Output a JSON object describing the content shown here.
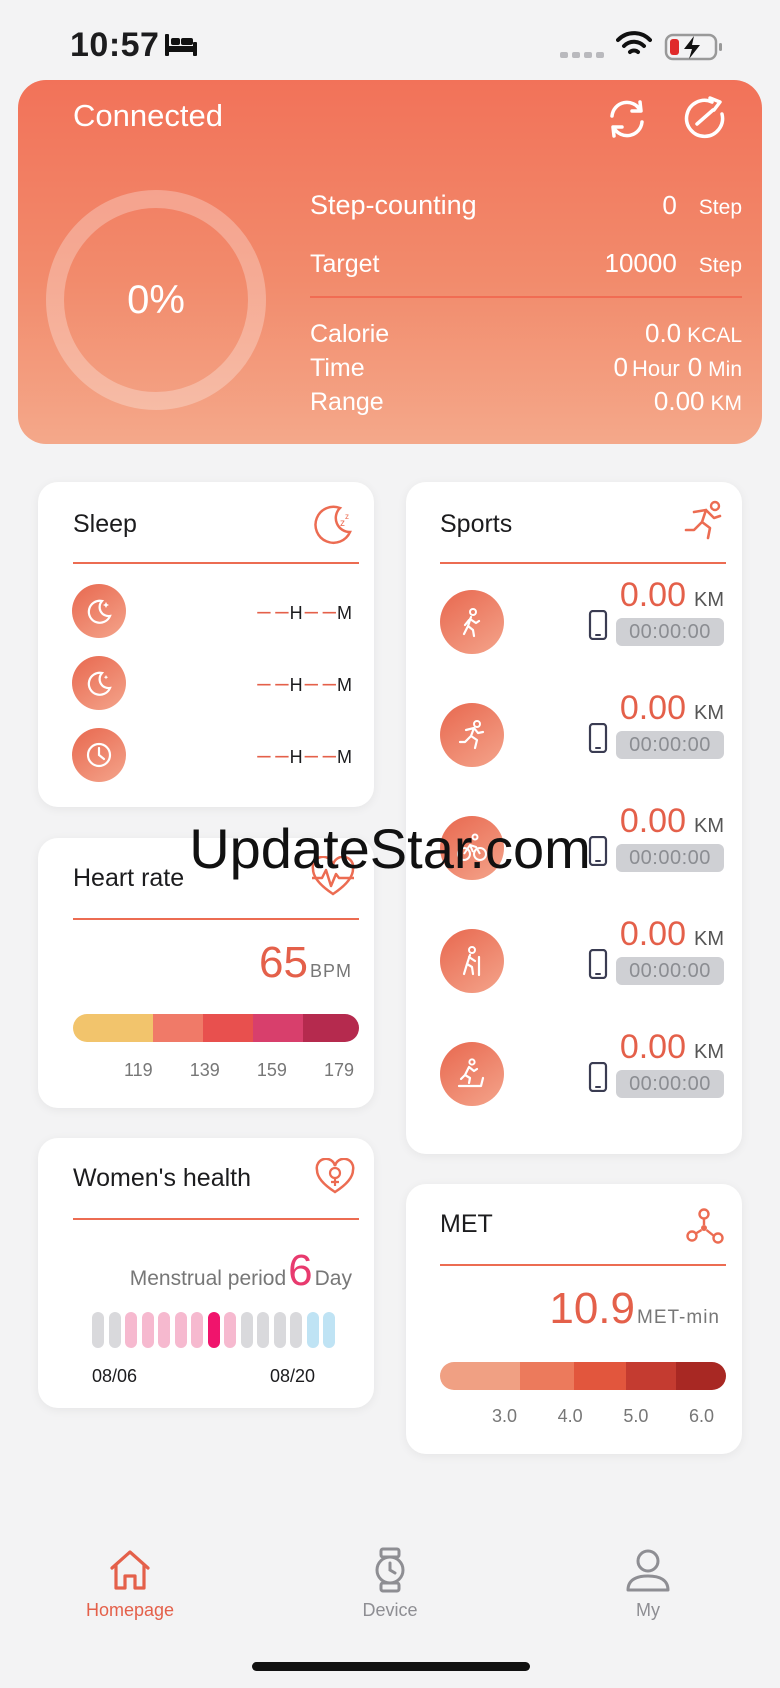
{
  "status_bar": {
    "time": "10:57"
  },
  "header": {
    "connection": "Connected",
    "progress_pct": 0,
    "progress_label": "0%",
    "step_label": "Step-counting",
    "step_value": "0",
    "step_unit": "Step",
    "target_label": "Target",
    "target_value": "10000",
    "target_unit": "Step",
    "calorie_label": "Calorie",
    "calorie_value": "0.0",
    "calorie_unit": "KCAL",
    "time_label": "Time",
    "time_hours": "0",
    "time_hour_unit": "Hour",
    "time_mins": "0",
    "time_min_unit": "Min",
    "range_label": "Range",
    "range_value": "0.00",
    "range_unit": "KM"
  },
  "sleep": {
    "title": "Sleep",
    "rows": [
      {
        "icon": "moon-stars-icon",
        "h": "– –",
        "h_unit": "H",
        "m": "– –",
        "m_unit": "M"
      },
      {
        "icon": "moon-icon",
        "h": "– –",
        "h_unit": "H",
        "m": "– –",
        "m_unit": "M"
      },
      {
        "icon": "clock-icon",
        "h": "– –",
        "h_unit": "H",
        "m": "– –",
        "m_unit": "M"
      }
    ]
  },
  "heart_rate": {
    "title": "Heart rate",
    "value": "65",
    "unit": "BPM",
    "ticks": [
      "119",
      "139",
      "159",
      "179"
    ],
    "zone_colors": [
      "#f2c46c",
      "#f07a68",
      "#e8504e",
      "#d83f6c",
      "#b52a4e"
    ]
  },
  "womens_health": {
    "title": "Women's health",
    "label": "Menstrual period",
    "value": "6",
    "unit": "Day",
    "start_date": "08/06",
    "end_date": "08/20",
    "day_colors": [
      "#d9d9dc",
      "#d9d9dc",
      "#f6b9cf",
      "#f6b9cf",
      "#f6b9cf",
      "#f6b9cf",
      "#f6b9cf",
      "#f0146c",
      "#f6b9cf",
      "#d9d9dc",
      "#d9d9dc",
      "#d9d9dc",
      "#d9d9dc",
      "#bfe3f4",
      "#bfe3f4"
    ]
  },
  "sports": {
    "title": "Sports",
    "rows": [
      {
        "icon": "walking-icon",
        "value": "0.00",
        "unit": "KM",
        "duration": "00:00:00"
      },
      {
        "icon": "running-icon",
        "value": "0.00",
        "unit": "KM",
        "duration": "00:00:00"
      },
      {
        "icon": "cycling-icon",
        "value": "0.00",
        "unit": "KM",
        "duration": "00:00:00"
      },
      {
        "icon": "hiking-icon",
        "value": "0.00",
        "unit": "KM",
        "duration": "00:00:00"
      },
      {
        "icon": "treadmill-icon",
        "value": "0.00",
        "unit": "KM",
        "duration": "00:00:00"
      }
    ]
  },
  "met": {
    "title": "MET",
    "value": "10.9",
    "unit": "MET-min",
    "ticks": [
      "3.0",
      "4.0",
      "5.0",
      "6.0"
    ],
    "zone_colors": [
      "#f0a083",
      "#ec7a5c",
      "#e2563d",
      "#c43b30",
      "#a82823"
    ]
  },
  "nav": {
    "items": [
      {
        "label": "Homepage",
        "icon": "home-icon",
        "active": true
      },
      {
        "label": "Device",
        "icon": "watch-icon",
        "active": false
      },
      {
        "label": "My",
        "icon": "person-icon",
        "active": false
      }
    ]
  },
  "watermark": "UpdateStar.com"
}
